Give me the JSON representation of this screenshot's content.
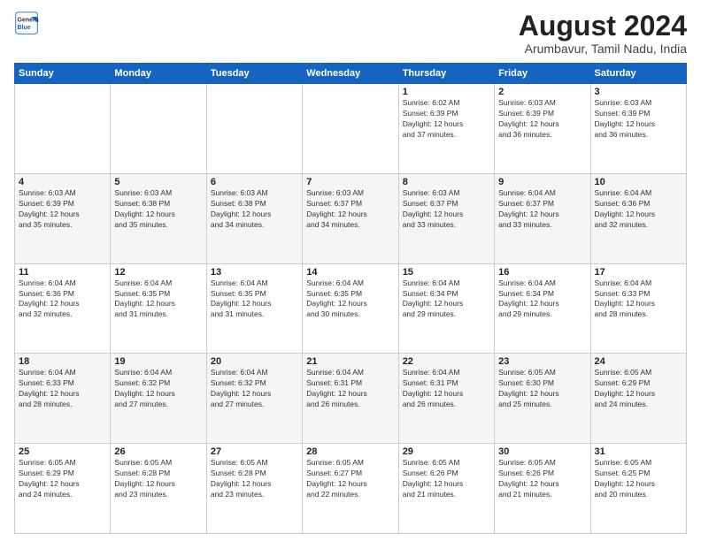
{
  "logo": {
    "general": "General",
    "blue": "Blue"
  },
  "title": {
    "month": "August 2024",
    "location": "Arumbavur, Tamil Nadu, India"
  },
  "days_of_week": [
    "Sunday",
    "Monday",
    "Tuesday",
    "Wednesday",
    "Thursday",
    "Friday",
    "Saturday"
  ],
  "weeks": [
    [
      {
        "day": "",
        "info": ""
      },
      {
        "day": "",
        "info": ""
      },
      {
        "day": "",
        "info": ""
      },
      {
        "day": "",
        "info": ""
      },
      {
        "day": "1",
        "info": "Sunrise: 6:02 AM\nSunset: 6:39 PM\nDaylight: 12 hours\nand 37 minutes."
      },
      {
        "day": "2",
        "info": "Sunrise: 6:03 AM\nSunset: 6:39 PM\nDaylight: 12 hours\nand 36 minutes."
      },
      {
        "day": "3",
        "info": "Sunrise: 6:03 AM\nSunset: 6:39 PM\nDaylight: 12 hours\nand 36 minutes."
      }
    ],
    [
      {
        "day": "4",
        "info": "Sunrise: 6:03 AM\nSunset: 6:39 PM\nDaylight: 12 hours\nand 35 minutes."
      },
      {
        "day": "5",
        "info": "Sunrise: 6:03 AM\nSunset: 6:38 PM\nDaylight: 12 hours\nand 35 minutes."
      },
      {
        "day": "6",
        "info": "Sunrise: 6:03 AM\nSunset: 6:38 PM\nDaylight: 12 hours\nand 34 minutes."
      },
      {
        "day": "7",
        "info": "Sunrise: 6:03 AM\nSunset: 6:37 PM\nDaylight: 12 hours\nand 34 minutes."
      },
      {
        "day": "8",
        "info": "Sunrise: 6:03 AM\nSunset: 6:37 PM\nDaylight: 12 hours\nand 33 minutes."
      },
      {
        "day": "9",
        "info": "Sunrise: 6:04 AM\nSunset: 6:37 PM\nDaylight: 12 hours\nand 33 minutes."
      },
      {
        "day": "10",
        "info": "Sunrise: 6:04 AM\nSunset: 6:36 PM\nDaylight: 12 hours\nand 32 minutes."
      }
    ],
    [
      {
        "day": "11",
        "info": "Sunrise: 6:04 AM\nSunset: 6:36 PM\nDaylight: 12 hours\nand 32 minutes."
      },
      {
        "day": "12",
        "info": "Sunrise: 6:04 AM\nSunset: 6:35 PM\nDaylight: 12 hours\nand 31 minutes."
      },
      {
        "day": "13",
        "info": "Sunrise: 6:04 AM\nSunset: 6:35 PM\nDaylight: 12 hours\nand 31 minutes."
      },
      {
        "day": "14",
        "info": "Sunrise: 6:04 AM\nSunset: 6:35 PM\nDaylight: 12 hours\nand 30 minutes."
      },
      {
        "day": "15",
        "info": "Sunrise: 6:04 AM\nSunset: 6:34 PM\nDaylight: 12 hours\nand 29 minutes."
      },
      {
        "day": "16",
        "info": "Sunrise: 6:04 AM\nSunset: 6:34 PM\nDaylight: 12 hours\nand 29 minutes."
      },
      {
        "day": "17",
        "info": "Sunrise: 6:04 AM\nSunset: 6:33 PM\nDaylight: 12 hours\nand 28 minutes."
      }
    ],
    [
      {
        "day": "18",
        "info": "Sunrise: 6:04 AM\nSunset: 6:33 PM\nDaylight: 12 hours\nand 28 minutes."
      },
      {
        "day": "19",
        "info": "Sunrise: 6:04 AM\nSunset: 6:32 PM\nDaylight: 12 hours\nand 27 minutes."
      },
      {
        "day": "20",
        "info": "Sunrise: 6:04 AM\nSunset: 6:32 PM\nDaylight: 12 hours\nand 27 minutes."
      },
      {
        "day": "21",
        "info": "Sunrise: 6:04 AM\nSunset: 6:31 PM\nDaylight: 12 hours\nand 26 minutes."
      },
      {
        "day": "22",
        "info": "Sunrise: 6:04 AM\nSunset: 6:31 PM\nDaylight: 12 hours\nand 26 minutes."
      },
      {
        "day": "23",
        "info": "Sunrise: 6:05 AM\nSunset: 6:30 PM\nDaylight: 12 hours\nand 25 minutes."
      },
      {
        "day": "24",
        "info": "Sunrise: 6:05 AM\nSunset: 6:29 PM\nDaylight: 12 hours\nand 24 minutes."
      }
    ],
    [
      {
        "day": "25",
        "info": "Sunrise: 6:05 AM\nSunset: 6:29 PM\nDaylight: 12 hours\nand 24 minutes."
      },
      {
        "day": "26",
        "info": "Sunrise: 6:05 AM\nSunset: 6:28 PM\nDaylight: 12 hours\nand 23 minutes."
      },
      {
        "day": "27",
        "info": "Sunrise: 6:05 AM\nSunset: 6:28 PM\nDaylight: 12 hours\nand 23 minutes."
      },
      {
        "day": "28",
        "info": "Sunrise: 6:05 AM\nSunset: 6:27 PM\nDaylight: 12 hours\nand 22 minutes."
      },
      {
        "day": "29",
        "info": "Sunrise: 6:05 AM\nSunset: 6:26 PM\nDaylight: 12 hours\nand 21 minutes."
      },
      {
        "day": "30",
        "info": "Sunrise: 6:05 AM\nSunset: 6:26 PM\nDaylight: 12 hours\nand 21 minutes."
      },
      {
        "day": "31",
        "info": "Sunrise: 6:05 AM\nSunset: 6:25 PM\nDaylight: 12 hours\nand 20 minutes."
      }
    ]
  ]
}
